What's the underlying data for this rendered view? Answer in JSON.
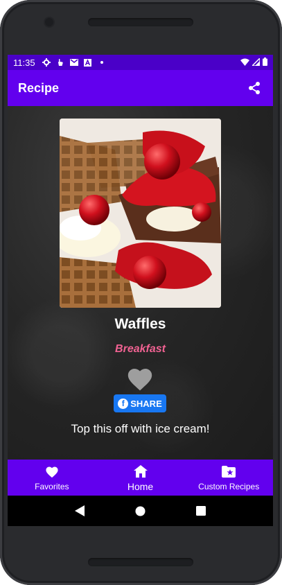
{
  "status_bar": {
    "time": "11:35",
    "icons": [
      "settings-icon",
      "touch-icon",
      "gmail-icon",
      "a-icon",
      "dot-icon"
    ],
    "right_icons": [
      "wifi-icon",
      "signal-icon",
      "battery-icon"
    ]
  },
  "app_bar": {
    "title": "Recipe",
    "action_icon": "share-icon"
  },
  "recipe": {
    "title": "Waffles",
    "category": "Breakfast",
    "favorite_icon": "heart-icon",
    "share_label": "SHARE",
    "share_icon_letter": "f",
    "note": "Top this off with ice cream!"
  },
  "bottom_nav": {
    "items": [
      {
        "label": "Favorites",
        "icon": "heart-icon"
      },
      {
        "label": "Home",
        "icon": "home-icon",
        "active": true
      },
      {
        "label": "Custom Recipes",
        "icon": "folder-star-icon"
      }
    ]
  },
  "system_nav": [
    "back-icon",
    "home-circle-icon",
    "recents-icon"
  ],
  "colors": {
    "status_bar": "#4a00c8",
    "primary": "#6200ee",
    "category_text": "#f06292",
    "facebook": "#1877f2",
    "favorite_heart": "#9e9e9e"
  }
}
